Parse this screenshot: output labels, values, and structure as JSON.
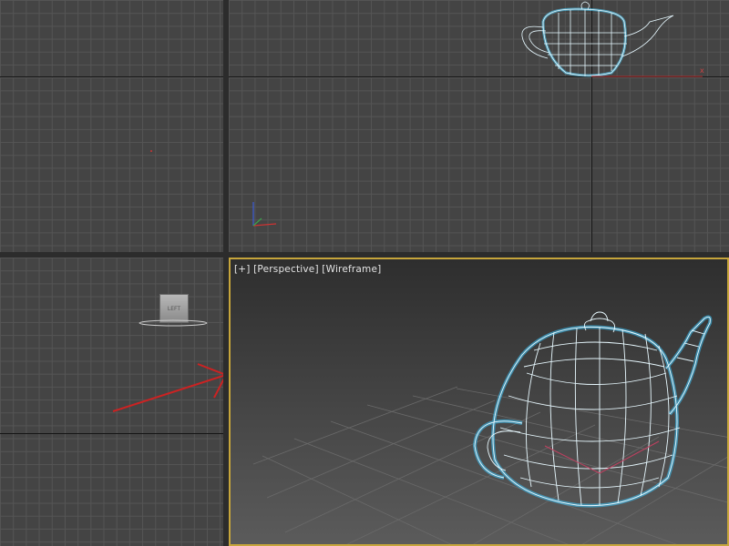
{
  "perspective_viewport": {
    "menu_label": "[+]",
    "view_label": "[Perspective]",
    "shading_label": "[Wireframe]"
  },
  "left_viewport": {
    "viewcube_label": "LEFT"
  },
  "colors": {
    "active_border": "#c6a53b",
    "wireframe": "#d8f4ff",
    "wireframe_glow": "#56d4ff",
    "arrow": "#cc2222"
  }
}
